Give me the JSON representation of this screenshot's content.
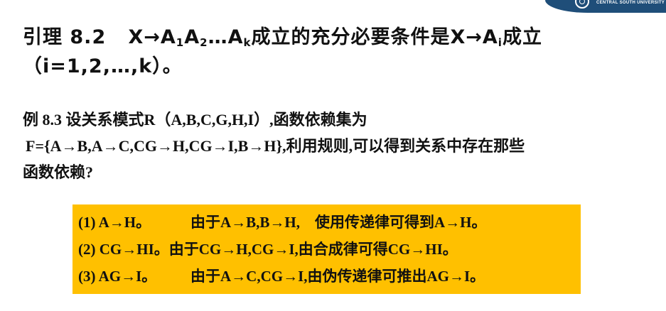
{
  "header": {
    "university_logo_text": "CENTRAL SOUTH UNIVERSITY",
    "logo_color": "#1f4e79"
  },
  "lemma": {
    "label": "引理 8.2",
    "statement_pre": "X→A",
    "sub1": "1",
    "mid1": "A",
    "sub2": "2",
    "mid2": "…A",
    "subk": "k",
    "statement_mid": "成立的充分必要条件是X→A",
    "subi": "i",
    "statement_end": "成立",
    "line2": "（i=1,2,…,k）。"
  },
  "example": {
    "line1": "例 8.3 设关系模式R（A,B,C,G,H,I）,函数依赖集为",
    "line2": "F={A→B,A→C,CG→H,CG→I,B→H},利用规则,可以得到关系中存在那些",
    "line3": "函数依赖?"
  },
  "derivations": {
    "highlight_color": "#ffc000",
    "rows": [
      {
        "premise": "(1) A→H。",
        "reason": "由于A→B,B→H,　使用传递律可得到A→H。"
      },
      {
        "premise": "(2) CG→HI。",
        "reason": "由于CG→H,CG→I,由合成律可得CG→HI。"
      },
      {
        "premise": "(3) AG→I。",
        "reason": "由于A→C,CG→I,由伪传递律可推出AG→I。"
      }
    ]
  }
}
